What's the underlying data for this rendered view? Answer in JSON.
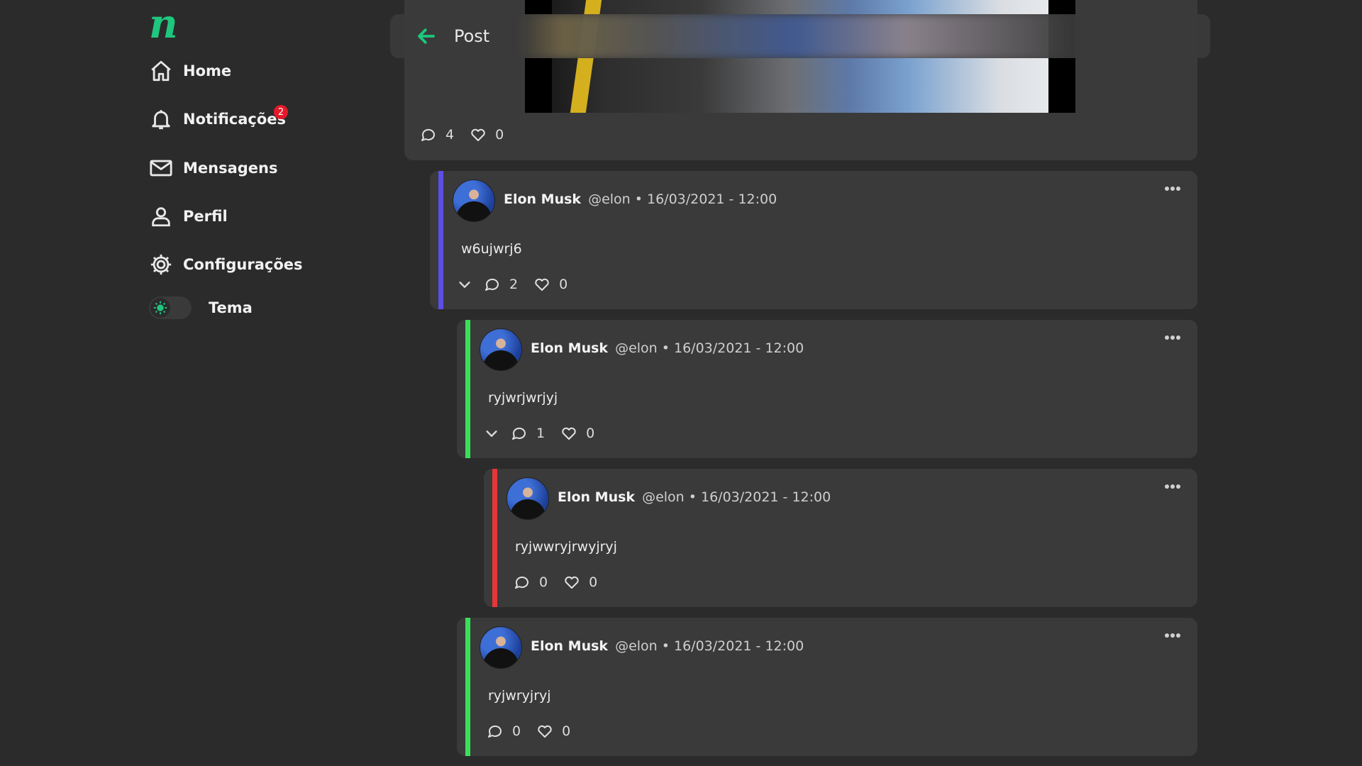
{
  "sidebar": {
    "logo": "n",
    "items": [
      {
        "label": "Home",
        "icon": "home-icon"
      },
      {
        "label": "Notificações",
        "icon": "bell-icon",
        "badge": "2"
      },
      {
        "label": "Mensagens",
        "icon": "mail-icon"
      },
      {
        "label": "Perfil",
        "icon": "user-icon"
      },
      {
        "label": "Configurações",
        "icon": "gear-icon"
      }
    ],
    "theme_label": "Tema"
  },
  "header": {
    "title": "Post"
  },
  "main_post": {
    "comments": "4",
    "likes": "0"
  },
  "colors": {
    "accent": "#1fc77e",
    "badge": "#e5192a",
    "thread_blue": "#5b4fe6",
    "thread_green": "#38e05a",
    "thread_red": "#e5363a"
  },
  "comments": [
    {
      "name": "Elon Musk",
      "handle": "@elon • 16/03/2021 - 12:00",
      "text": "w6ujwrj6",
      "replies": "2",
      "likes": "0"
    },
    {
      "name": "Elon Musk",
      "handle": "@elon • 16/03/2021 - 12:00",
      "text": "ryjwrjwrjyj",
      "replies": "1",
      "likes": "0"
    },
    {
      "name": "Elon Musk",
      "handle": "@elon • 16/03/2021 - 12:00",
      "text": "ryjwwryjrwyjryj",
      "replies": "0",
      "likes": "0"
    },
    {
      "name": "Elon Musk",
      "handle": "@elon • 16/03/2021 - 12:00",
      "text": "ryjwryjryj",
      "replies": "0",
      "likes": "0"
    }
  ]
}
